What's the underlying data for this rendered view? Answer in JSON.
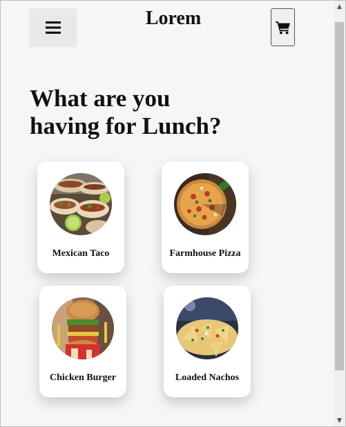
{
  "header": {
    "brand": "Lorem",
    "menu_icon": "hamburger-icon",
    "cart_icon": "shopping-cart-icon"
  },
  "main": {
    "heading_line1": "What are you",
    "heading_line2": "having for Lunch?"
  },
  "menu_items": [
    {
      "label": "Mexican Taco",
      "image": "tacos-photo"
    },
    {
      "label": "Farmhouse Pizza",
      "image": "pizza-photo"
    },
    {
      "label": "Chicken Burger",
      "image": "burger-photo"
    },
    {
      "label": "Loaded Nachos",
      "image": "nachos-photo"
    }
  ],
  "colors": {
    "page_background": "#f6f6f6",
    "card_background": "#ffffff",
    "menu_button_background": "#e9e9e9",
    "text": "#111111"
  },
  "scrollbar": {
    "up_icon": "triangle-up-icon",
    "down_icon": "triangle-down-icon"
  }
}
